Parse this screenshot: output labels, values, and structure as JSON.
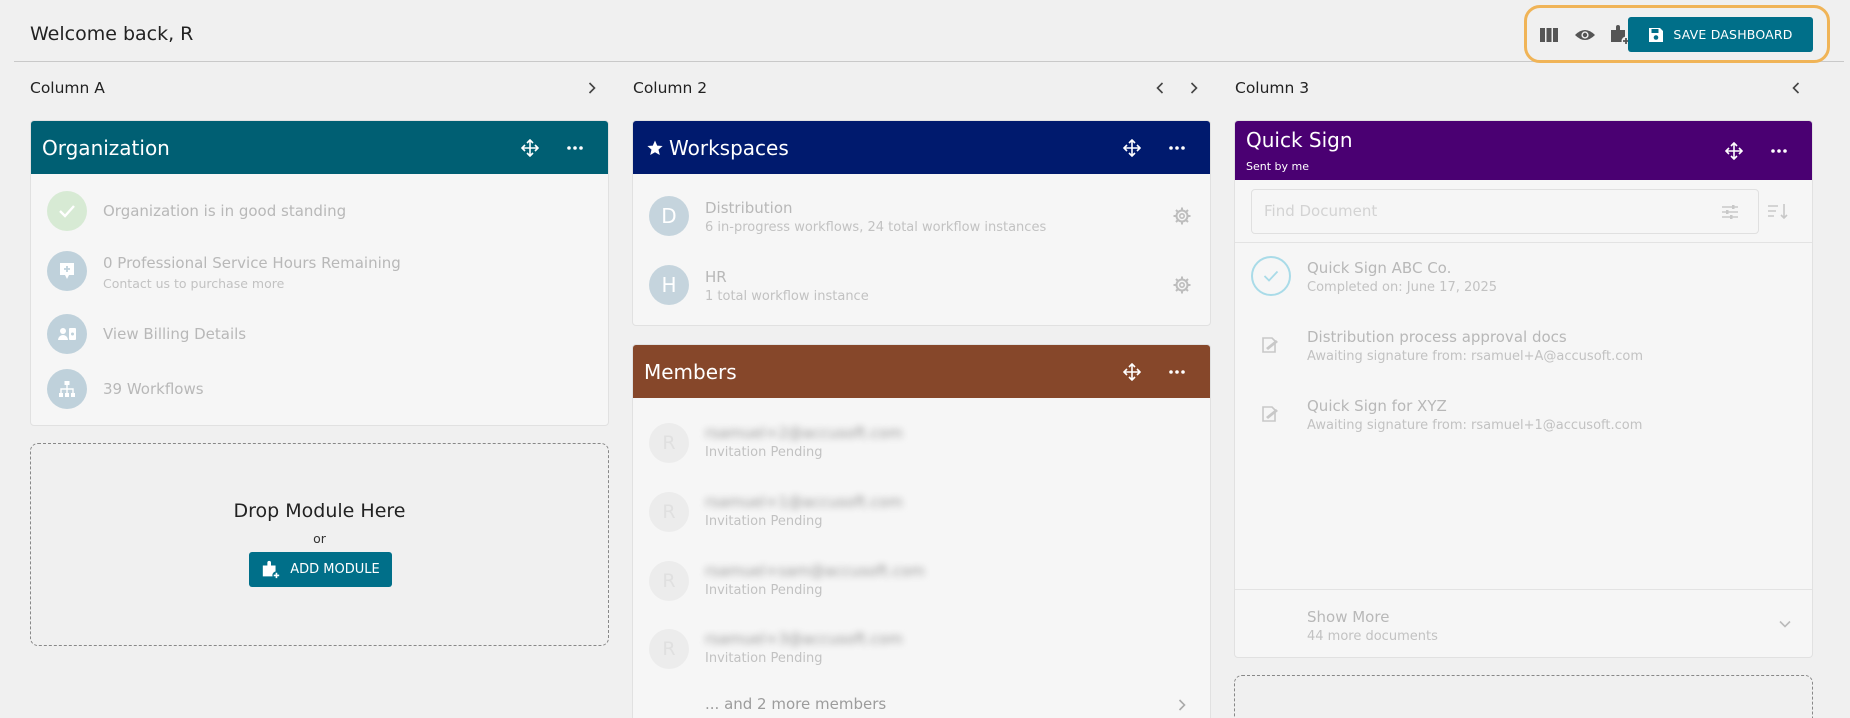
{
  "header": {
    "welcome": "Welcome back, R",
    "save_label": "SAVE DASHBOARD"
  },
  "columns": [
    {
      "title": "Column A"
    },
    {
      "title": "Column 2"
    },
    {
      "title": "Column 3"
    }
  ],
  "organization": {
    "title": "Organization",
    "items": [
      {
        "label": "Organization is in good standing",
        "icon": "check-icon"
      },
      {
        "label": "0 Professional Service Hours Remaining",
        "sub": "Contact us to purchase more",
        "icon": "service-hours-icon"
      },
      {
        "label": "View Billing Details",
        "icon": "billing-icon"
      },
      {
        "label": "39 Workflows",
        "icon": "workflow-hierarchy-icon"
      }
    ]
  },
  "dropzone": {
    "title": "Drop Module Here",
    "or": "or",
    "add_label": "ADD MODULE"
  },
  "workspaces": {
    "title": "Workspaces",
    "items": [
      {
        "initial": "D",
        "name": "Distribution",
        "detail": "6 in-progress workflows, 24 total workflow instances"
      },
      {
        "initial": "H",
        "name": "HR",
        "detail": "1 total workflow instance"
      }
    ]
  },
  "members": {
    "title": "Members",
    "items": [
      {
        "initial": "R",
        "email": "rsamuel+2@accusoft.com",
        "status": "Invitation Pending"
      },
      {
        "initial": "R",
        "email": "rsamuel+1@accusoft.com",
        "status": "Invitation Pending"
      },
      {
        "initial": "R",
        "email": "rsamuel+sam@accusoft.com",
        "status": "Invitation Pending"
      },
      {
        "initial": "R",
        "email": "rsamuel+3@accusoft.com",
        "status": "Invitation Pending"
      }
    ],
    "more": "... and 2 more members"
  },
  "quicksign": {
    "title": "Quick Sign",
    "subtitle": "Sent by me",
    "search_placeholder": "Find Document",
    "items": [
      {
        "title": "Quick Sign ABC Co.",
        "detail": "Completed on: June 17, 2025",
        "icon": "completed-check-icon"
      },
      {
        "title": "Distribution process approval docs",
        "detail": "Awaiting signature from: rsamuel+A@accusoft.com",
        "icon": "signature-pending-icon"
      },
      {
        "title": "Quick Sign for XYZ",
        "detail": "Awaiting signature from: rsamuel+1@accusoft.com",
        "icon": "signature-pending-icon"
      }
    ],
    "show_more": "Show More",
    "show_more_sub": "44 more documents"
  },
  "colors": {
    "organization": "#005f73",
    "workspaces": "#001a6e",
    "members": "#86472a",
    "quicksign": "#4a0072",
    "primary_button": "#006f89",
    "highlight": "#f0b457"
  }
}
